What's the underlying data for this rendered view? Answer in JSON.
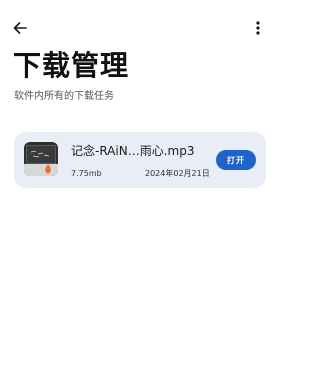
{
  "header": {
    "back_icon": "arrow-left-icon",
    "more_icon": "more-vertical-icon",
    "title": "下载管理",
    "subtitle": "软件内所有的下载任务"
  },
  "downloads": [
    {
      "thumbnail_icon": "audio-file-thumbnail",
      "name": "记念-RAiN…雨心.mp3",
      "size": "7.75mb",
      "date": "2024年02月21日",
      "action_label": "打开"
    }
  ],
  "colors": {
    "card_background": "#e9edf5",
    "accent": "#1d63c9",
    "text_primary": "#111111"
  }
}
